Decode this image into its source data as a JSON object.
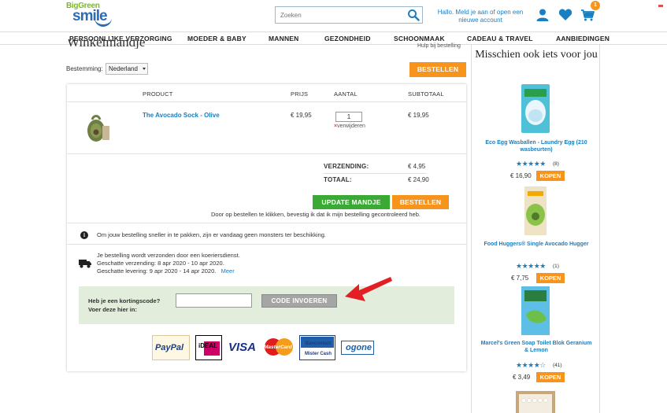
{
  "header": {
    "logo_line1": "BigGreen",
    "logo_line2": "smile",
    "search_placeholder": "Zoeken",
    "account_line1": "Hallo. Meld je aan of open een",
    "account_line2": "nieuwe account",
    "cart_count": "1",
    "accent_color": "#1a7fc1"
  },
  "nav": {
    "items": [
      "PERSOONLIJKE VERZORGING",
      "MOEDER & BABY",
      "MANNEN",
      "GEZONDHEID",
      "SCHOONMAAK",
      "CADEAU & TRAVEL",
      "AANBIEDINGEN"
    ]
  },
  "page": {
    "title": "Winkelmandje",
    "help_link": "Hulp bij bestelling"
  },
  "destination": {
    "label": "Bestemming:",
    "value": "Nederland"
  },
  "buttons": {
    "order_top": "BESTELLEN",
    "update_cart": "UPDATE MANDJE",
    "order_bottom": "BESTELLEN",
    "enter_code": "CODE INVOEREN"
  },
  "table": {
    "headers": {
      "product": "PRODUCT",
      "price": "PRIJS",
      "quantity": "AANTAL",
      "subtotal": "SUBTOTAAL"
    },
    "rows": [
      {
        "name": "The Avocado Sock - Olive",
        "price": "€ 19,95",
        "quantity": "1",
        "remove": "verwijderen",
        "subtotal": "€ 19,95"
      }
    ]
  },
  "totals": {
    "shipping_label": "VERZENDING:",
    "shipping_value": "€ 4,95",
    "total_label": "TOTAAL:",
    "total_value": "€ 24,90"
  },
  "confirm_note": "Door op bestellen te klikken, bevestig ik dat ik mijn bestelling gecontroleerd heb.",
  "info": {
    "samples": "Om jouw bestelling sneller in te pakken, zijn er vandaag geen monsters ter beschikking.",
    "shipping_line1": "Je bestelling wordt verzonden door een koeriersdienst.",
    "shipping_line2": "Geschatte verzending: 8 apr 2020 - 10 apr 2020.",
    "shipping_line3": "Geschatte levering: 9 apr 2020 - 14 apr 2020.",
    "more_link": "Meer"
  },
  "discount": {
    "label_line1": "Heb je een kortingscode?",
    "label_line2": "Voer deze hier in:",
    "value": ""
  },
  "payment_methods": [
    "PayPal",
    "iDEAL",
    "VISA",
    "MasterCard",
    "Bancontact Mister Cash",
    "ogone"
  ],
  "sidebar": {
    "title": "Misschien ook iets voor jou",
    "products": [
      {
        "name": "Eco Egg Wasballen - Laundry Egg (210 wasbeurten)",
        "stars": "★★★★★",
        "rating_count": "(8)",
        "price": "€ 16,90",
        "buy": "KOPEN",
        "rating": 5
      },
      {
        "name": "Food Huggers® Single Avocado Hugger",
        "stars": "★★★★★",
        "rating_count": "(1)",
        "price": "€ 7,75",
        "buy": "KOPEN",
        "rating": 5
      },
      {
        "name": "Marcel's Green Soap Toilet Blok Geranium & Lemon",
        "stars": "★★★★☆",
        "rating_count": "(41)",
        "price": "€ 3,49",
        "buy": "KOPEN",
        "rating": 4
      }
    ]
  }
}
